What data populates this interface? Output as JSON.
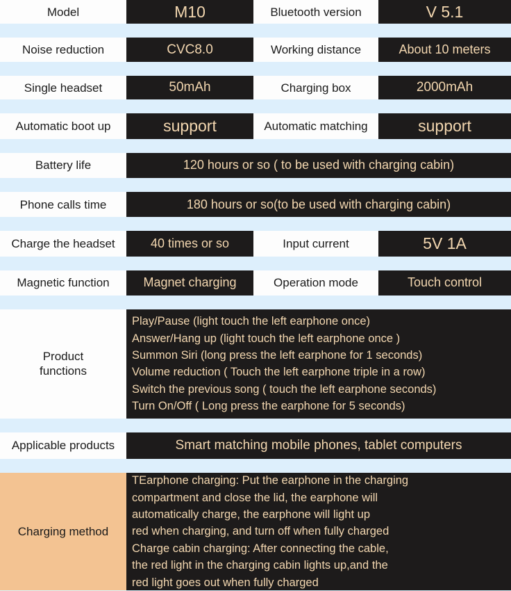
{
  "meta": {
    "title": "M10 Bluetooth Earphone Specification Table",
    "background_color": "#ddeffc",
    "value_cell_bg": "#1d1b1b",
    "value_text_color": "#f3d7b0",
    "label_cell_bg": "#fdfdfd",
    "highlight_label_bg": "#f3c392"
  },
  "rows": [
    {
      "label_1": "Model",
      "value_1": "M10",
      "label_2": "Bluetooth version",
      "value_2": "V 5.1"
    },
    {
      "label_1": "Noise reduction",
      "value_1": "CVC8.0",
      "label_2": "Working distance",
      "value_2": "About 10 meters"
    },
    {
      "label_1": "Single headset",
      "value_1": "50mAh",
      "label_2": "Charging box",
      "value_2": "2000mAh"
    },
    {
      "label_1": "Automatic boot up",
      "value_1": "support",
      "label_2": "Automatic matching",
      "value_2": "support"
    },
    {
      "label_1": "Battery life",
      "value_1": "120 hours or so ( to be used with charging cabin)"
    },
    {
      "label_1": "Phone calls time",
      "value_1": "180 hours or so(to be used with charging cabin)"
    },
    {
      "label_1": "Charge the headset",
      "value_1": "40 times or so",
      "label_2": "Input current",
      "value_2": "5V 1A"
    },
    {
      "label_1": "Magnetic function",
      "value_1": "Magnet charging",
      "label_2": "Operation mode",
      "value_2": "Touch control"
    }
  ],
  "product_functions": {
    "label": "Product functions",
    "label_line_1": "Product",
    "label_line_2": "functions",
    "lines": [
      "Play/Pause (light touch the left earphone once)",
      "Answer/Hang up (light touch the left earphone once )",
      "Summon Siri (long press the left earphone for 1 seconds)",
      "Volume reduction ( Touch the left earphone triple in a row)",
      "Switch the previous song ( touch the left earphone seconds)",
      "Turn On/Off ( Long press the earphone for 5 seconds)"
    ]
  },
  "applicable_products": {
    "label": "Applicable products",
    "value": "Smart matching mobile phones, tablet computers"
  },
  "charging_method": {
    "label": "Charging method",
    "lines": [
      "TEarphone charging:  Put the earphone in the charging",
      "compartment and close the lid, the earphone will",
      "automatically charge, the earphone will light up",
      "red when charging, and turn off when fully charged",
      "Charge cabin charging: After connecting the cable,",
      "the red light in the charging cabin lights up,and the",
      "red light goes out when fully charged"
    ]
  }
}
